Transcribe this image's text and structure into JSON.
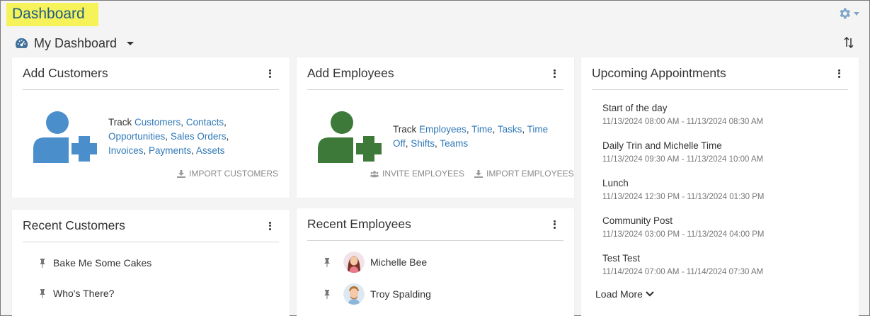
{
  "page": {
    "title": "Dashboard"
  },
  "header": {
    "dashboard_name": "My Dashboard"
  },
  "add_customers": {
    "title": "Add Customers",
    "track_word": "Track",
    "links": [
      "Customers",
      "Contacts",
      "Opportunities",
      "Sales Orders",
      "Invoices",
      "Payments",
      "Assets"
    ],
    "import_label": "IMPORT CUSTOMERS"
  },
  "add_employees": {
    "title": "Add Employees",
    "track_word": "Track",
    "links": [
      "Employees",
      "Time",
      "Tasks",
      "Time Off",
      "Shifts",
      "Teams"
    ],
    "invite_label": "INVITE EMPLOYEES",
    "import_label": "IMPORT EMPLOYEES"
  },
  "upcoming": {
    "title": "Upcoming Appointments",
    "items": [
      {
        "title": "Start of the day",
        "start": "11/13/2024 08:00 AM",
        "end": "11/13/2024 08:30 AM"
      },
      {
        "title": "Daily Trin and Michelle Time",
        "start": "11/13/2024 09:30 AM",
        "end": "11/13/2024 10:00 AM"
      },
      {
        "title": "Lunch",
        "start": "11/13/2024 12:30 PM",
        "end": "11/13/2024 01:30 PM"
      },
      {
        "title": "Community Post",
        "start": "11/13/2024 03:00 PM",
        "end": "11/13/2024 04:00 PM"
      },
      {
        "title": "Test Test",
        "start": "11/14/2024 07:00 AM",
        "end": "11/14/2024 07:30 AM"
      }
    ],
    "separator": "-",
    "load_more": "Load More"
  },
  "recent_customers": {
    "title": "Recent Customers",
    "items": [
      "Bake Me Some Cakes",
      "Who's There?"
    ]
  },
  "recent_employees": {
    "title": "Recent Employees",
    "items": [
      "Michelle Bee",
      "Troy Spalding"
    ]
  },
  "colors": {
    "title_highlight": "#f6f35a",
    "link": "#2f78b7",
    "customer_icon": "#4a8ecc",
    "employee_icon": "#3d7a3a"
  },
  "icons": {
    "gear": "gear-icon",
    "dashboard": "dashboard-gauge-icon",
    "sort": "sort-icon",
    "kebab": "kebab-menu-icon",
    "pin": "pin-icon",
    "download": "download-icon",
    "users": "users-icon",
    "chevron": "chevron-down-icon"
  }
}
